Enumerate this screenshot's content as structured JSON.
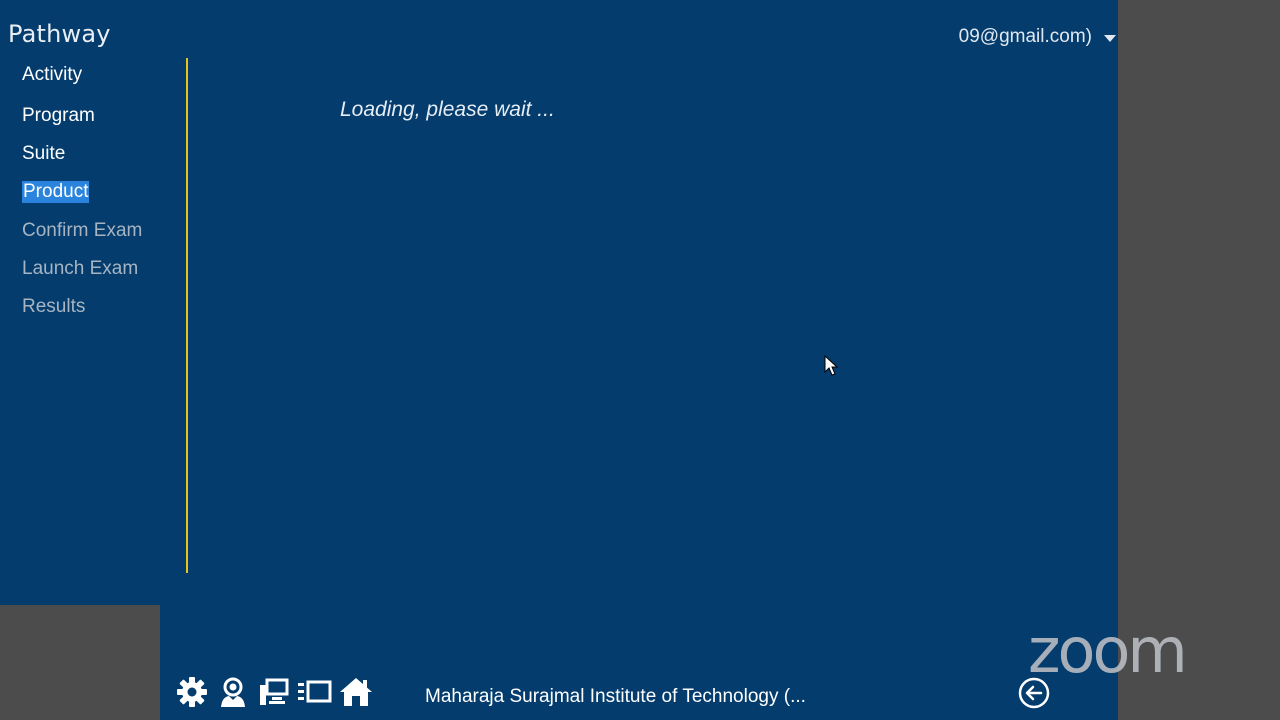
{
  "app": {
    "title": "Pathway",
    "account": "09@gmail.com)"
  },
  "nav": {
    "items": [
      {
        "label": "Activity",
        "state": "enabled"
      },
      {
        "label": "Program",
        "state": "enabled"
      },
      {
        "label": "Suite",
        "state": "enabled"
      },
      {
        "label": "Product",
        "state": "selected"
      },
      {
        "label": "Confirm Exam",
        "state": "disabled"
      },
      {
        "label": "Launch Exam",
        "state": "disabled"
      },
      {
        "label": "Results",
        "state": "disabled"
      }
    ]
  },
  "main": {
    "status": "Loading, please wait ..."
  },
  "footer": {
    "institute": "Maharaja Surajmal Institute of Technology  (...",
    "icons": [
      "gear-icon",
      "user-badge-icon",
      "network-icon",
      "display-list-icon",
      "home-icon"
    ]
  },
  "overlay": {
    "brand": "zoom",
    "back_icon": "back-arrow-circle-icon"
  },
  "colors": {
    "app_background": "#033c6d",
    "divider": "#e8c21d",
    "selection": "#2a84dd",
    "frame_gray": "#4d4c4c"
  }
}
